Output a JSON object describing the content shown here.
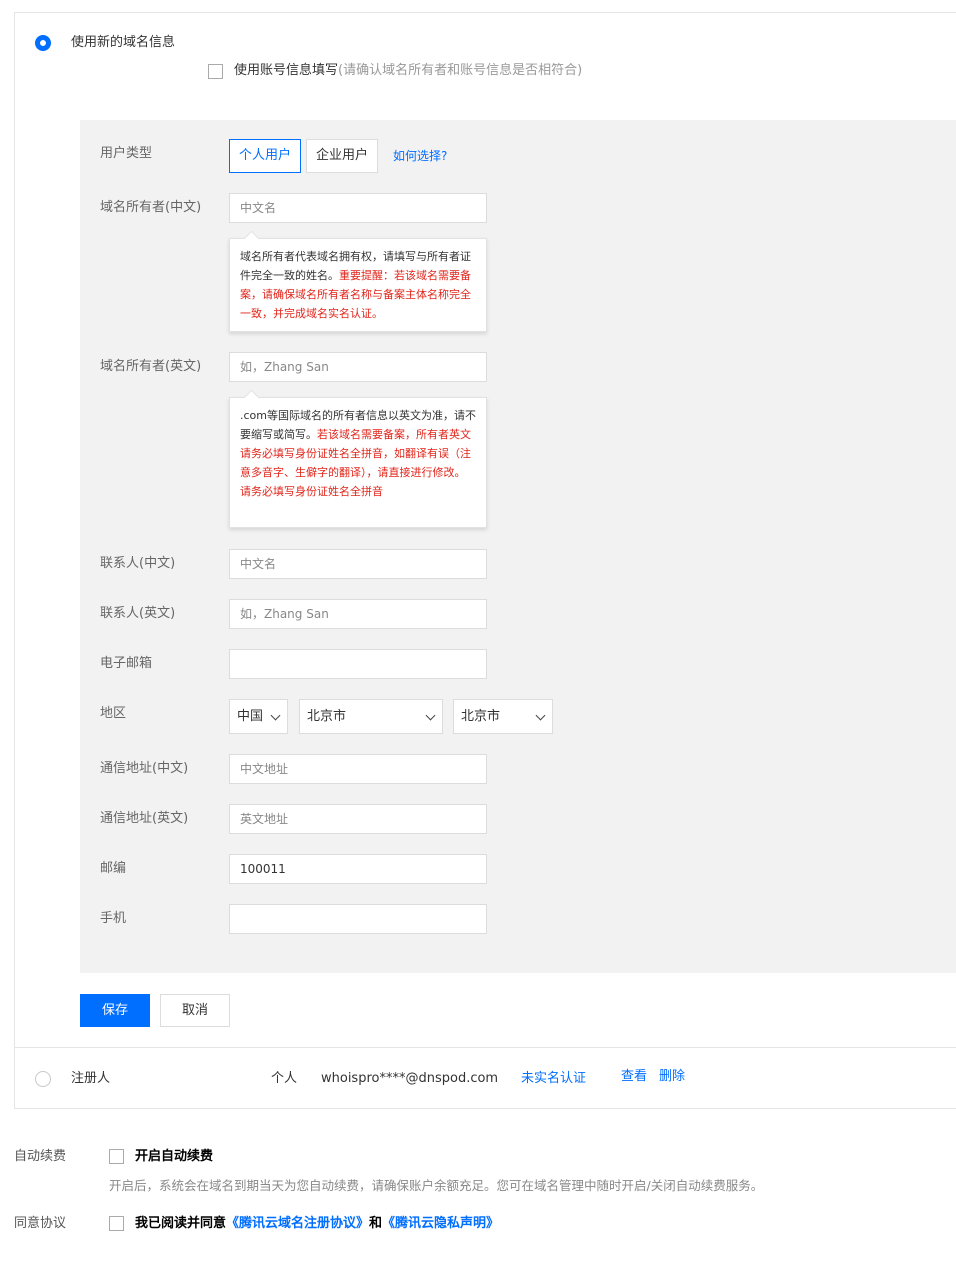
{
  "new_domain_info": {
    "label": "使用新的域名信息",
    "use_account_label": "使用账号信息填写",
    "use_account_hint": "(请确认域名所有者和账号信息是否相符合)"
  },
  "form": {
    "user_type_label": "用户类型",
    "user_type_options": [
      "个人用户",
      "企业用户"
    ],
    "how_to_choose": "如何选择?",
    "owner_cn_label": "域名所有者(中文)",
    "owner_cn_placeholder": "中文名",
    "owner_cn_tip_normal": "域名所有者代表域名拥有权，请填写与所有者证件完全一致的姓名。",
    "owner_cn_tip_red": "重要提醒：若该域名需要备案，请确保域名所有者名称与备案主体名称完全一致，并完成域名实名认证。",
    "owner_en_label": "域名所有者(英文)",
    "owner_en_placeholder": "如，Zhang San",
    "owner_en_tip_normal": ".com等国际域名的所有者信息以英文为准，请不要缩写或简写。",
    "owner_en_tip_red": "若该域名需要备案，所有者英文请务必填写身份证姓名全拼音，如翻译有误（注意多音字、生僻字的翻译），请直接进行修改。请务必填写身份证姓名全拼音",
    "contact_cn_label": "联系人(中文)",
    "contact_cn_placeholder": "中文名",
    "contact_en_label": "联系人(英文)",
    "contact_en_placeholder": "如，Zhang San",
    "email_label": "电子邮箱",
    "email_value": "",
    "region_label": "地区",
    "region_country": "中国",
    "region_province": "北京市",
    "region_city": "北京市",
    "address_cn_label": "通信地址(中文)",
    "address_cn_placeholder": "中文地址",
    "address_en_label": "通信地址(英文)",
    "address_en_placeholder": "英文地址",
    "zip_label": "邮编",
    "zip_value": "100011",
    "mobile_label": "手机",
    "mobile_value": ""
  },
  "actions": {
    "save": "保存",
    "cancel": "取消"
  },
  "registrant": {
    "label": "注册人",
    "type": "个人",
    "email": "whoispro****@dnspod.com",
    "status": "未实名认证",
    "view": "查看",
    "delete": "删除"
  },
  "auto_renew": {
    "label": "自动续费",
    "checkbox_label": "开启自动续费",
    "description": "开启后，系统会在域名到期当天为您自动续费，请确保账户余额充足。您可在域名管理中随时开启/关闭自动续费服务。"
  },
  "agreement": {
    "label": "同意协议",
    "prefix": "我已阅读并同意",
    "link1": "《腾讯云域名注册协议》",
    "and": "和",
    "link2": "《腾讯云隐私声明》"
  },
  "colors": {
    "accent": "#006eff",
    "warning": "#e1251b"
  }
}
